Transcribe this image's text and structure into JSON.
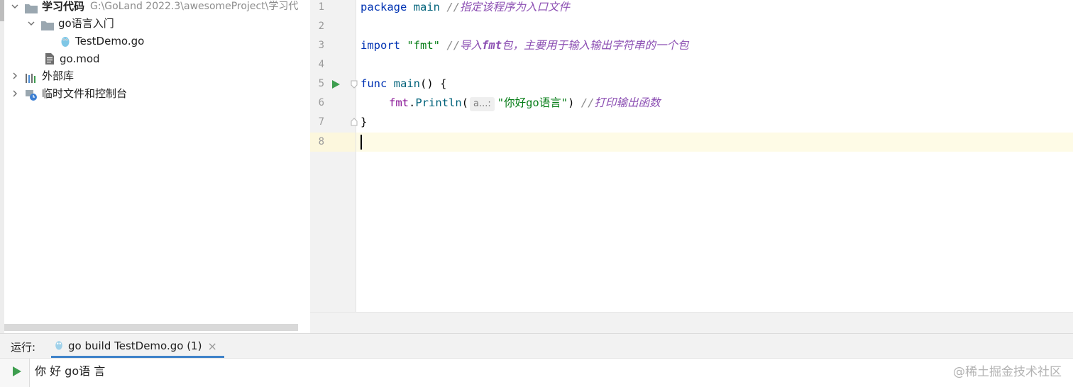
{
  "project_tree": {
    "root": {
      "label": "学习代码",
      "path_hint": "G:\\GoLand 2022.3\\awesomeProject\\学习代"
    },
    "folder": {
      "label": "go语言入门"
    },
    "file_go": {
      "label": "TestDemo.go"
    },
    "file_mod": {
      "label": "go.mod"
    },
    "external_libs": {
      "label": "外部库"
    },
    "scratches": {
      "label": "临时文件和控制台"
    }
  },
  "editor": {
    "line_numbers": [
      "1",
      "2",
      "3",
      "4",
      "5",
      "6",
      "7",
      "8"
    ],
    "lines": {
      "l1": {
        "kw": "package",
        "name": "main",
        "comment_prefix": "//",
        "comment": "指定该程序为入口文件"
      },
      "l3": {
        "kw": "import",
        "str": "\"fmt\"",
        "comment_prefix": "//",
        "comment_a": "导入",
        "comment_b": "fmt",
        "comment_c": "包，主要用于输入输出字符串的一个包"
      },
      "l5": {
        "kw": "func",
        "name": "main",
        "rest": "() {"
      },
      "l6": {
        "pkg": "fmt",
        "dot": ".",
        "fn": "Println",
        "paren_open": "(",
        "hint": "a...:",
        "str": "\"你好go语言\"",
        "paren_close": ")",
        "comment_prefix": "//",
        "comment": "打印输出函数"
      },
      "l7": {
        "text": "}"
      }
    }
  },
  "run_window": {
    "label": "运行:",
    "tab_label": "go build TestDemo.go (1)",
    "close_glyph": "×",
    "output": "你 好 go语 言",
    "watermark": "@稀土掘金技术社区"
  },
  "colors": {
    "keyword": "#0033b3",
    "function": "#00627a",
    "string": "#067d17",
    "comment": "#8c4fb3",
    "caret_line": "#fefbe6",
    "run_green": "#3e9e4f",
    "tab_underline": "#4083c9"
  }
}
